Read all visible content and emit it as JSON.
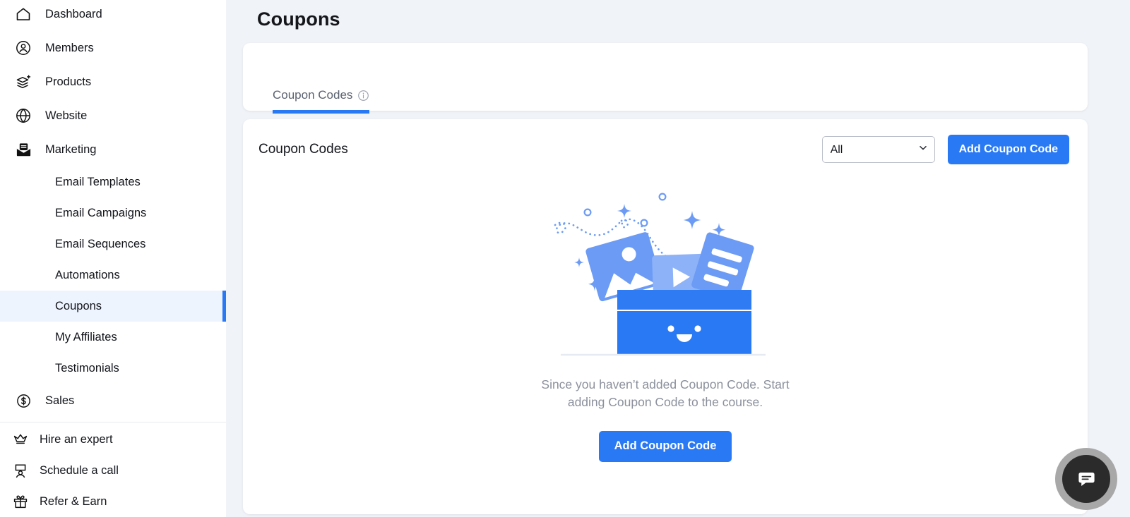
{
  "sidebar": {
    "items": [
      {
        "label": "Dashboard",
        "icon": "home-icon",
        "type": "top"
      },
      {
        "label": "Members",
        "icon": "user-circle-icon",
        "type": "top"
      },
      {
        "label": "Products",
        "icon": "layers-plus-icon",
        "type": "top"
      },
      {
        "label": "Website",
        "icon": "globe-icon",
        "type": "top"
      },
      {
        "label": "Marketing",
        "icon": "envelope-icon",
        "type": "top"
      },
      {
        "label": "Email Templates",
        "icon": "",
        "type": "sub"
      },
      {
        "label": "Email Campaigns",
        "icon": "",
        "type": "sub"
      },
      {
        "label": "Email Sequences",
        "icon": "",
        "type": "sub"
      },
      {
        "label": "Automations",
        "icon": "",
        "type": "sub"
      },
      {
        "label": "Coupons",
        "icon": "",
        "type": "sub",
        "active": true
      },
      {
        "label": "My Affiliates",
        "icon": "",
        "type": "sub"
      },
      {
        "label": "Testimonials",
        "icon": "",
        "type": "sub"
      },
      {
        "label": "Sales",
        "icon": "dollar-circle-icon",
        "type": "top"
      }
    ],
    "bottom_items": [
      {
        "label": "Hire an expert",
        "icon": "crown-icon"
      },
      {
        "label": "Schedule a call",
        "icon": "person-screen-icon"
      },
      {
        "label": "Refer & Earn",
        "icon": "gift-icon"
      }
    ],
    "active_indicator_color": "#2979f5",
    "active_background": "#eef4fe"
  },
  "page": {
    "title": "Coupons"
  },
  "tabs": [
    {
      "label": "Coupon Codes",
      "info_icon": "info-icon",
      "active": true
    }
  ],
  "panel": {
    "title": "Coupon Codes",
    "filter": {
      "selected": "All",
      "options": [
        "All"
      ]
    },
    "add_button_label": "Add Coupon Code"
  },
  "empty_state": {
    "illustration": "open-box-with-media-cards-illustration",
    "message": "Since you haven’t added Coupon Code. Start adding Coupon Code to the course.",
    "button_label": "Add Coupon Code"
  },
  "chat": {
    "icon": "chat-bubble-icon"
  },
  "colors": {
    "accent": "#2979f5",
    "page_background": "#f0f3f8",
    "card_background": "#ffffff",
    "muted_text": "#8b909c"
  }
}
